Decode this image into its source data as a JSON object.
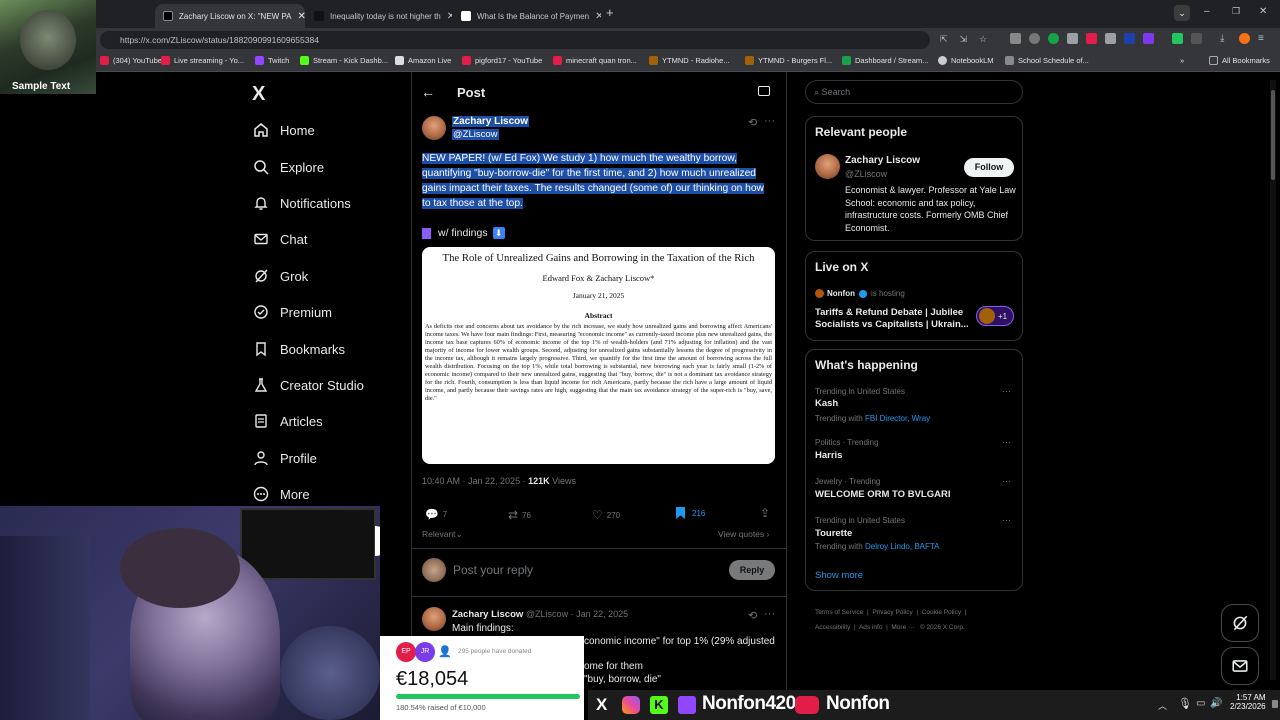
{
  "browser": {
    "tabs": [
      {
        "label": "Zachary Liscow on X: \"NEW PA"
      },
      {
        "label": "Inequality today is not higher th"
      },
      {
        "label": "What Is the Balance of Paymen"
      }
    ],
    "url": "https://x.com/ZLiscow/status/1882090991609655384",
    "bookmarks": [
      "(304) YouTube",
      "Live streaming - Yo...",
      "Twitch",
      "Stream - Kick Dashb...",
      "Amazon Live",
      "pigford17 - YouTube",
      "minecraft quan tron...",
      "YTMND - Radiohe...",
      "YTMND - Burgers Fl...",
      "Dashboard / Stream...",
      "NotebookLM",
      "School Schedule of..."
    ],
    "all_bookmarks": "All Bookmarks"
  },
  "overlay": {
    "sample_text": "Sample Text"
  },
  "sidebar": {
    "logo": "X",
    "items": [
      {
        "label": "Home"
      },
      {
        "label": "Explore"
      },
      {
        "label": "Notifications"
      },
      {
        "label": "Chat"
      },
      {
        "label": "Grok"
      },
      {
        "label": "Premium"
      },
      {
        "label": "Bookmarks"
      },
      {
        "label": "Creator Studio"
      },
      {
        "label": "Articles"
      },
      {
        "label": "Profile"
      },
      {
        "label": "More"
      }
    ]
  },
  "post": {
    "header_title": "Post",
    "author_name": "Zachary Liscow",
    "author_handle": "@ZLiscow",
    "text": "NEW PAPER! (w/ Ed Fox) We study 1) how much the wealthy borrow, quantifying \"buy-borrow-die\" for the first time, and 2) how much unrealized gains impact their taxes. The results changed (some of) our thinking on how to tax those at the top.",
    "thread_note": "w/ findings",
    "paper": {
      "title": "The Role of Unrealized Gains and Borrowing in the Taxation of the Rich",
      "authors": "Edward Fox & Zachary Liscow*",
      "date": "January 21, 2025",
      "abstract_heading": "Abstract",
      "abstract": "As deficits rise and concerns about tax avoidance by the rich increase, we study how unrealized gains and borrowing affect Americans' income taxes. We have four main findings: First, measuring \"economic income\" as currently-taxed income plus new unrealized gains, the income tax base captures 60% of economic income of the top 1% of wealth-holders (and 71% adjusting for inflation) and the vast majority of income for lower wealth groups. Second, adjusting for unrealized gains substantially lessens the degree of progressivity in the income tax, although it remains largely progressive. Third, we quantify for the first time the amount of borrowing across the full wealth distribution. Focusing on the top 1%, while total borrowing is substantial, new borrowing each year is fairly small (1-2% of economic income) compared to their new unrealized gains, suggesting that \"buy, borrow, die\" is not a dominant tax avoidance strategy for the rich. Fourth, consumption is less than liquid income for rich Americans, partly because the rich have a large amount of liquid income, and partly because their savings rates are high, suggesting that the main tax avoidance strategy of the super-rich is \"buy, save, die.\""
    },
    "timestamp": "10:40 AM · Jan 22, 2025",
    "views_count": "121K",
    "views_label": "Views",
    "replies": "7",
    "reposts": "76",
    "likes": "270",
    "bookmarks": "216",
    "sort_label": "Relevant",
    "view_quotes": "View quotes",
    "reply_placeholder": "Post your reply",
    "reply_button": "Reply"
  },
  "reply_post": {
    "author_name": "Zachary Liscow",
    "meta": "@ZLiscow · Jan 22, 2025",
    "line1": "Main findings:",
    "line2": "conomic income\" for top 1% (29% adjusted",
    "line3": "ome for them",
    "line4": "\"buy, borrow, die\""
  },
  "right": {
    "search_placeholder": "Search",
    "relevant_title": "Relevant people",
    "person_name": "Zachary Liscow",
    "person_handle": "@ZLiscow",
    "follow": "Follow",
    "person_bio": "Economist & lawyer. Professor at Yale Law School: economic and tax policy, infrastructure costs. Formerly OMB Chief Economist.",
    "live_title": "Live on X",
    "live_host": "Nonfon",
    "live_hosting": "is hosting",
    "live_topic": "Tariffs & Refund Debate | Jubilee Socialists vs Capitalists | Ukrain...",
    "live_plus": "+1",
    "happening_title": "What's happening",
    "trends": [
      {
        "context": "Trending in United States",
        "name": "Kash",
        "with_label": "Trending with",
        "with": "FBI Director, Wray"
      },
      {
        "context": "Politics · Trending",
        "name": "Harris",
        "with_label": "",
        "with": ""
      },
      {
        "context": "Jewelry · Trending",
        "name": "WELCOME ORM TO BVLGARI",
        "with_label": "",
        "with": ""
      },
      {
        "context": "Trending in United States",
        "name": "Tourette",
        "with_label": "Trending with",
        "with": "Delroy Lindo, BAFTA"
      }
    ],
    "show_more": "Show more",
    "footer": [
      "Terms of Service",
      "Privacy Policy",
      "Cookie Policy",
      "Accessibility",
      "Ads info",
      "More ···",
      "© 2026 X Corp."
    ]
  },
  "donation": {
    "avatars": [
      "EP",
      "JR"
    ],
    "donors_text": "295 people have donated",
    "amount": "€18,054",
    "progress_fraction": 1.0,
    "raised_text": "180.54% raised of €10,000"
  },
  "stream_bar": {
    "channel1": "Nonfon420",
    "channel2": "Nonfon"
  },
  "taskbar": {
    "time": "1:57 AM",
    "date": "2/23/2026"
  },
  "colors": {
    "accent": "#1d9bf0",
    "selection": "#1d4fa8",
    "green": "#22c55e"
  }
}
